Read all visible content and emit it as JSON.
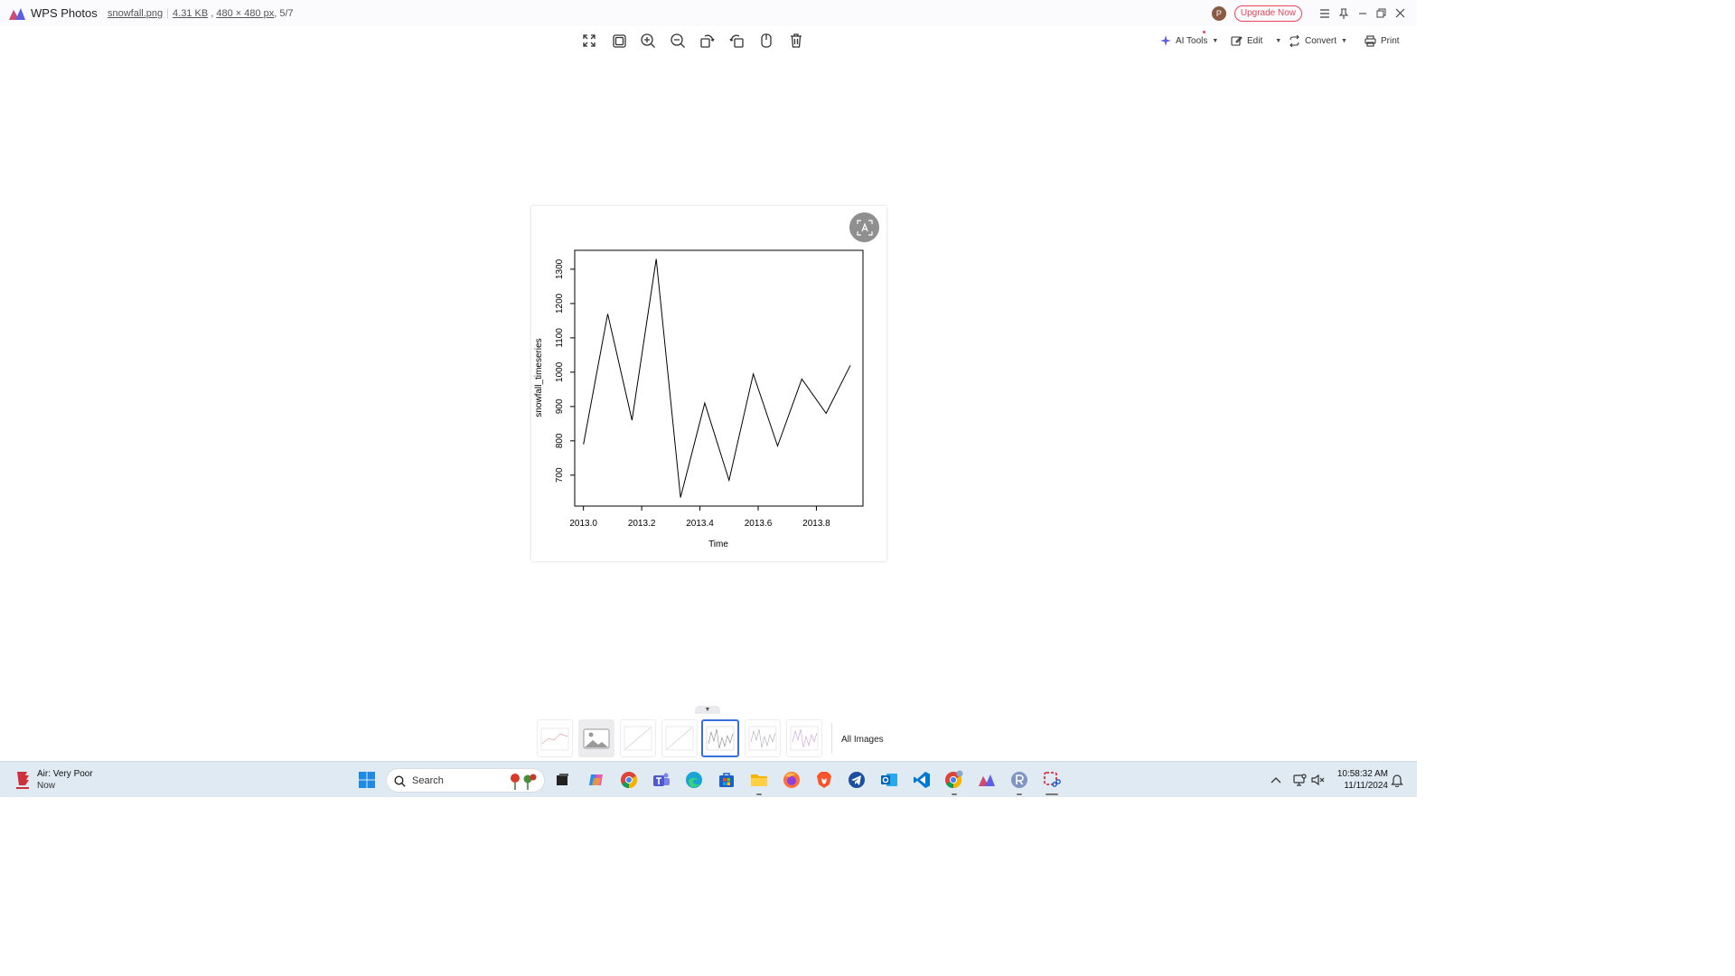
{
  "app": {
    "name": "WPS Photos",
    "file_name": "snowfall.png",
    "file_size": "4.31 KB",
    "dimensions": "480 × 480 px",
    "position": "5/7",
    "upgrade_label": "Upgrade Now",
    "avatar_letter": "P"
  },
  "toolbar": {
    "ai_tools": "AI Tools",
    "edit": "Edit",
    "convert": "Convert",
    "print": "Print"
  },
  "thumbnails": {
    "all_images": "All Images",
    "count": 7,
    "active_index": 4
  },
  "chart_data": {
    "type": "line",
    "title": "",
    "xlabel": "Time",
    "ylabel": "snowfall_timeseries",
    "x_ticks": [
      "2013.0",
      "2013.2",
      "2013.4",
      "2013.6",
      "2013.8"
    ],
    "y_ticks": [
      "700",
      "800",
      "900",
      "1000",
      "1100",
      "1200",
      "1300"
    ],
    "xlim": [
      2012.97,
      2013.96
    ],
    "ylim": [
      610,
      1355
    ],
    "grid": false,
    "x": [
      2013.0,
      2013.0833,
      2013.1667,
      2013.25,
      2013.3333,
      2013.4167,
      2013.5,
      2013.5833,
      2013.6667,
      2013.75,
      2013.8333,
      2013.9167
    ],
    "values": [
      790,
      1170,
      860,
      1330,
      635,
      910,
      685,
      995,
      785,
      980,
      880,
      1020
    ]
  },
  "taskbar": {
    "weather_title": "Air: Very Poor",
    "weather_sub": "Now",
    "search_label": "Search",
    "time": "10:58:32 AM",
    "date": "11/11/2024"
  },
  "colors": {
    "accent": "#3a6fe0",
    "upgrade": "#e8455a",
    "taskbar": "#dfeaf3"
  }
}
